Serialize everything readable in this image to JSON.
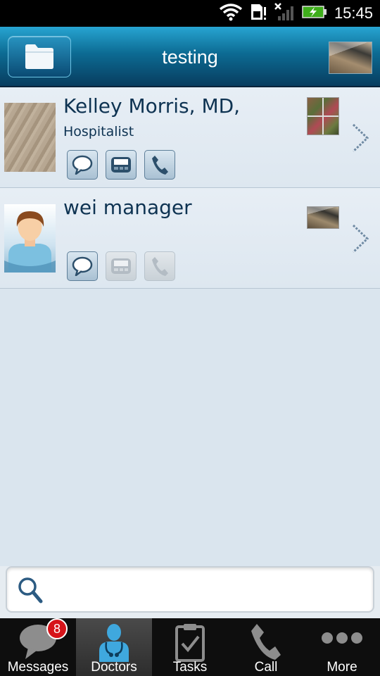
{
  "status_bar": {
    "time": "15:45"
  },
  "header": {
    "title": "testing"
  },
  "contacts": [
    {
      "name": "Kelley Morris, MD,",
      "subtitle": "Hospitalist"
    },
    {
      "name": "wei manager",
      "subtitle": ""
    }
  ],
  "search": {
    "value": "",
    "placeholder": ""
  },
  "tabs": [
    {
      "label": "Messages",
      "badge": "8"
    },
    {
      "label": "Doctors"
    },
    {
      "label": "Tasks"
    },
    {
      "label": "Call"
    },
    {
      "label": "More"
    }
  ],
  "colors": {
    "header_top": "#27a5d2",
    "header_bottom": "#083d5f",
    "name_text": "#0e3352",
    "list_bg": "#dae5ee"
  }
}
